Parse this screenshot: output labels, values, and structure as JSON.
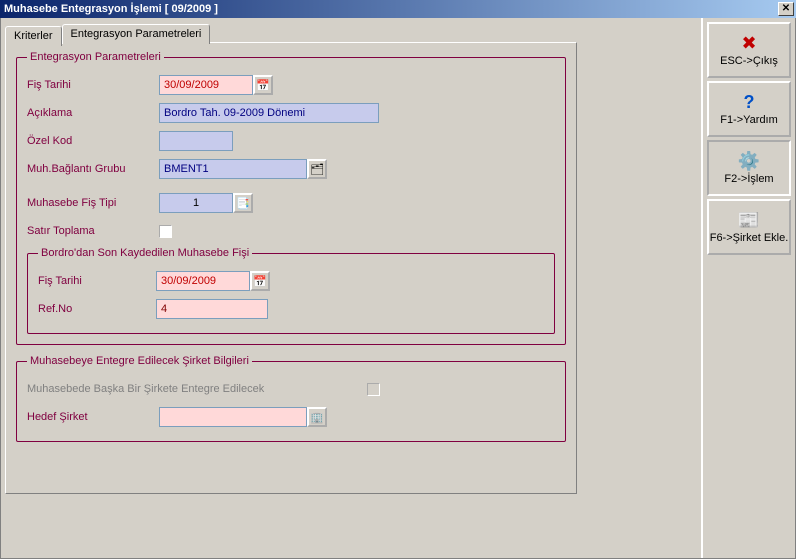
{
  "window": {
    "title": "Muhasebe Entegrasyon İşlemi [ 09/2009  ]"
  },
  "tabs": {
    "kriterler": "Kriterler",
    "parametreler": "Entegrasyon Parametreleri"
  },
  "group1": {
    "legend": "Entegrasyon Parametreleri",
    "fis_tarihi_label": "Fiş Tarihi",
    "fis_tarihi_value": "30/09/2009",
    "aciklama_label": "Açıklama",
    "aciklama_value": "Bordro Tah. 09-2009 Dönemi",
    "ozel_kod_label": "Özel Kod",
    "ozel_kod_value": "",
    "muh_baglanti_label": "Muh.Bağlantı Grubu",
    "muh_baglanti_value": "BMENT1",
    "muh_fis_tipi_label": "Muhasebe Fiş Tipi",
    "muh_fis_tipi_value": "1",
    "satir_toplama_label": "Satır Toplama"
  },
  "group2": {
    "legend": "Bordro'dan  Son Kaydedilen Muhasebe Fişi",
    "fis_tarihi_label": "Fiş Tarihi",
    "fis_tarihi_value": "30/09/2009",
    "refno_label": "Ref.No",
    "refno_value": "4"
  },
  "group3": {
    "legend": "Muhasebeye Entegre Edilecek Şirket Bilgileri",
    "chk_label": "Muhasebede Başka Bir Şirkete Entegre Edilecek",
    "hedef_label": "Hedef Şirket",
    "hedef_value": ""
  },
  "sidebar": {
    "esc": "ESC->Çıkış",
    "f1": "F1->Yardım",
    "f2": "F2->İşlem",
    "f6": "F6->Şirket Ekle."
  }
}
